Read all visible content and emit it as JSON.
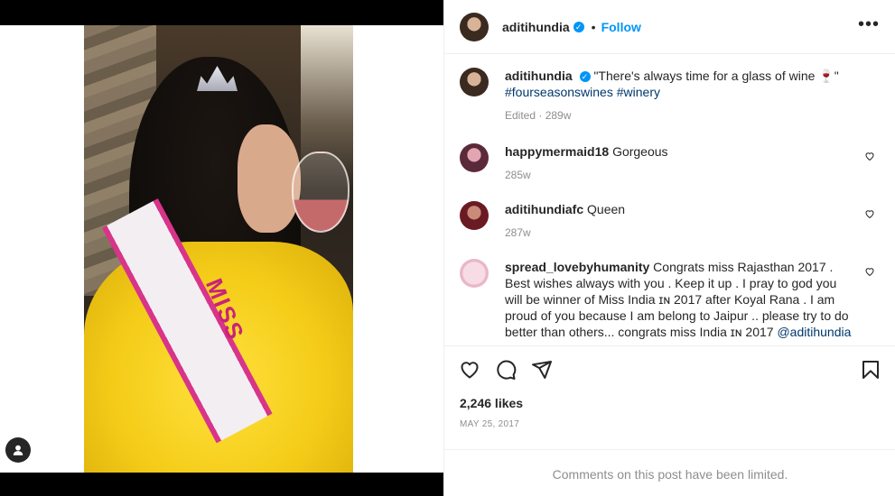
{
  "post": {
    "author": "aditihundia",
    "verified_icon": "verified-badge-icon",
    "dot": "•",
    "follow_label": "Follow",
    "more_icon": "more-options-icon"
  },
  "caption": {
    "username": "aditihundia",
    "text": "\"There's always time for a glass of wine 🍷\"",
    "hashtags": "#fourseasonswines #winery",
    "meta": "Edited · 289w"
  },
  "comments": [
    {
      "username": "happymermaid18",
      "text": "Gorgeous",
      "meta": "285w"
    },
    {
      "username": "aditihundiafc",
      "text": "Queen",
      "meta": "287w"
    },
    {
      "username": "spread_lovebyhumanity",
      "text": "Congrats miss Rajasthan 2017 . Best wishes always with you . Keep it up . I pray to god you will be winner of Miss India ɪɴ 2017 after Koyal Rana . I am proud of you because I am belong to Jaipur .. please try to do better than others... congrats miss India ɪɴ 2017",
      "mention": "@aditihundia"
    }
  ],
  "actions": {
    "likes": "2,246 likes",
    "date": "MAY 25, 2017",
    "limited_notice": "Comments on this post have been limited."
  },
  "media": {
    "sash_text": "MISS"
  },
  "colors": {
    "accent": "#0095f6",
    "muted": "#8e8e8e",
    "link": "#00376b"
  }
}
